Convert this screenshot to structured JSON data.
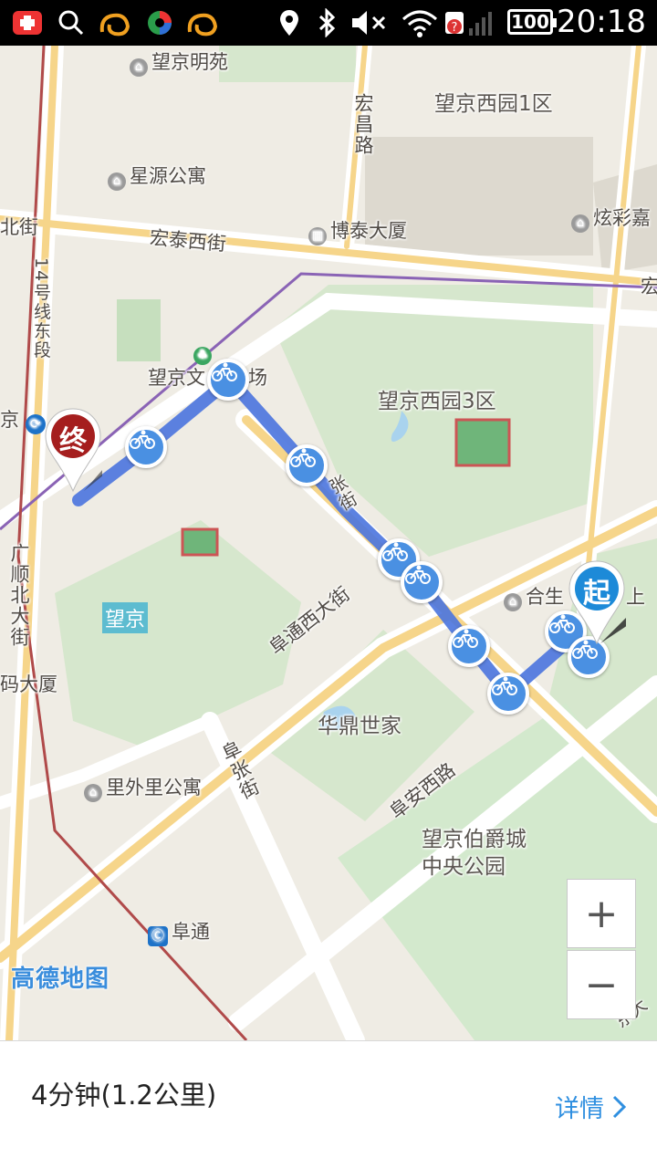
{
  "status_bar": {
    "time": "20:18",
    "battery": "100",
    "icons": [
      "add-app-icon",
      "search-icon",
      "uc-browser-icon",
      "color-ball-icon",
      "uc-browser-icon",
      "location-icon",
      "bluetooth-icon",
      "mute-icon",
      "wifi-icon",
      "signal-icon",
      "battery-icon"
    ]
  },
  "map": {
    "labels": {
      "wangjing_mingyuan": "望京明苑",
      "wangjing_xiyuan_1": "望京西园1区",
      "hongchang_road": "宏昌路",
      "xingyuan_apt": "星源公寓",
      "xuancai": "炫彩嘉",
      "bei_street": "北街",
      "hongtai_west_st": "宏泰西街",
      "botai_tower": "博泰大厦",
      "hong_right": "宏",
      "line14": "14号线东段",
      "wangjing_culture": "望京文",
      "culture_tail": "场",
      "wangjing_xiyuan_3": "望京西园3区",
      "station_jing": "京",
      "fu_street_fragment": "张街",
      "guangshun_north": "广顺北大街",
      "wangjing_area": "望京",
      "hesheng": "合生",
      "hesheng_tail": "上",
      "futong_west_st": "阜通西大街",
      "ma_tower": "码大厦",
      "huading": "华鼎世家",
      "fuzhang_street": "阜张街",
      "fuan_west_road": "阜安西路",
      "liwaili_apt": "里外里公寓",
      "park_line1": "望京伯爵城",
      "park_line2": "中央公园",
      "futong_station": "阜通",
      "dong_fragment": "东大"
    },
    "start_label": "起",
    "end_label": "终",
    "zoom_in": "+",
    "zoom_out": "−",
    "logo": "高德地图",
    "route_color": "#4a74de",
    "bike_stop_color": "#4a90e2"
  },
  "route_summary": {
    "duration_distance": "4分钟(1.2公里)",
    "detail_label": "详情"
  }
}
